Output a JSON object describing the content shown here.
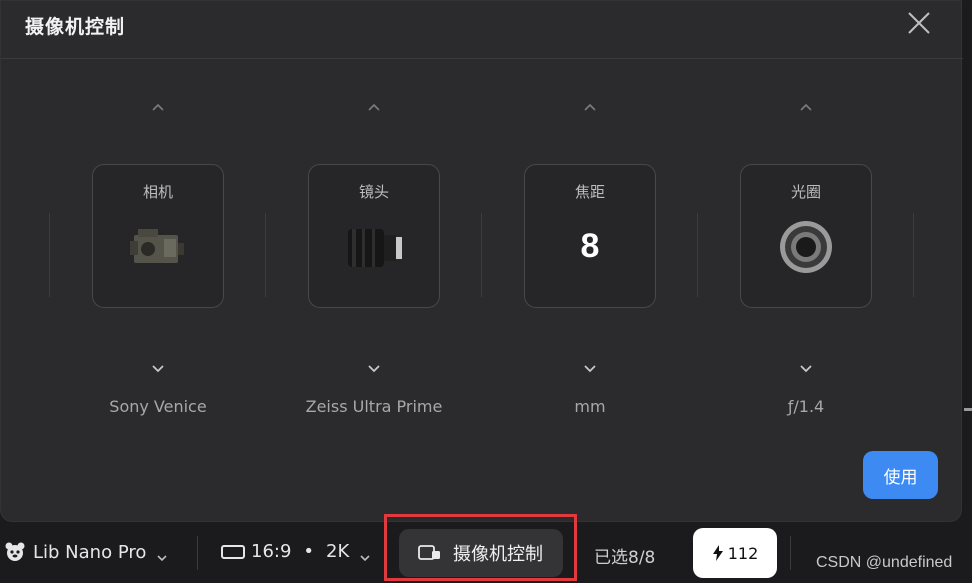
{
  "dialog": {
    "title": "摄像机控制",
    "apply_label": "使用"
  },
  "columns": [
    {
      "label": "相机",
      "value": "Sony Venice",
      "icon": "camera-body-image"
    },
    {
      "label": "镜头",
      "value": "Zeiss Ultra Prime",
      "icon": "lens-image"
    },
    {
      "label": "焦距",
      "display": "8",
      "value": "mm"
    },
    {
      "label": "光圈",
      "value": "ƒ/1.4",
      "icon": "aperture-image"
    }
  ],
  "bottombar": {
    "model": "Lib Nano Pro",
    "aspect": "16:9",
    "separator": "•",
    "resolution": "2K",
    "camera_control": "摄像机控制",
    "selected": "已选8/8",
    "credits": "112"
  },
  "watermark": "CSDN @undefined",
  "colors": {
    "accent": "#3d8bf2",
    "highlight": "#e0393e"
  }
}
